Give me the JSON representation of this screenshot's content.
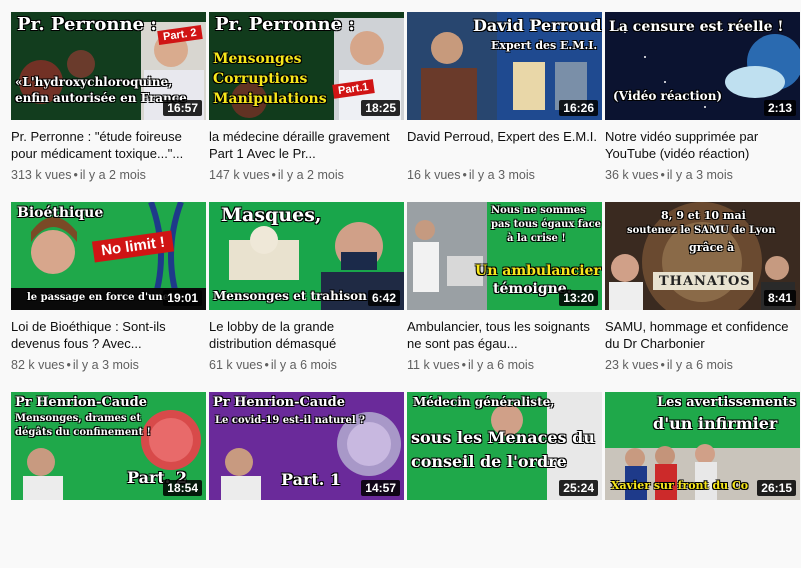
{
  "videos": [
    {
      "thumb_title": "Pr. Perronne :",
      "thumb_text": "«L'hydroxychloroquine,",
      "thumb_text2": "enfin autorisée en France",
      "badge": "Part. 2",
      "duration": "16:57",
      "title": "Pr. Perronne : \"étude foireuse pour médicament toxique...\"...",
      "views": "313 k vues",
      "age": "il y a 2 mois"
    },
    {
      "thumb_title": "Pr. Perronne :",
      "thumb_text": "Mensonges",
      "thumb_text2": "Corruptions",
      "thumb_text3": "Manipulations",
      "badge": "Part.1",
      "duration": "18:25",
      "title": "la médecine déraille gravement Part 1 Avec le Pr...",
      "views": "147 k vues",
      "age": "il y a 2 mois"
    },
    {
      "thumb_title": "David Perroud",
      "thumb_text": "Expert des E.M.I.",
      "duration": "16:26",
      "title": "David Perroud, Expert des E.M.I.",
      "views": "16 k vues",
      "age": "il y a 3 mois"
    },
    {
      "thumb_title": "La censure est réelle !",
      "thumb_text": "(Vidéo réaction)",
      "duration": "2:13",
      "title": "Notre vidéo supprimée par YouTube (vidéo réaction)",
      "views": "36 k vues",
      "age": "il y a 3 mois"
    },
    {
      "thumb_title": "Bioéthique",
      "thumb_text": "No limit !",
      "thumb_text2": "le passage en force d'une",
      "duration": "19:01",
      "title": "Loi de Bioéthique : Sont-ils devenus fous ? Avec...",
      "views": "82 k vues",
      "age": "il y a 3 mois"
    },
    {
      "thumb_title": "Masques,",
      "thumb_text": "Mensonges et trahison",
      "duration": "6:42",
      "title": "Le lobby de la grande distribution démasqué",
      "views": "61 k vues",
      "age": "il y a 6 mois"
    },
    {
      "thumb_title": "Nous ne sommes",
      "thumb_text": "pas tous égaux face",
      "thumb_text2": "à la crise !",
      "thumb_text3": "Un ambulancier",
      "thumb_text4": "témoigne.",
      "duration": "13:20",
      "title": "Ambulancier, tous les soignants ne sont pas égau...",
      "views": "11 k vues",
      "age": "il y a 6 mois"
    },
    {
      "thumb_title": "8, 9 et 10 mai",
      "thumb_text": "soutenez le SAMU de Lyon",
      "thumb_text2": "grâce à",
      "thumb_text3": "THANATOS",
      "duration": "8:41",
      "title": "SAMU, hommage et confidence du Dr Charbonier",
      "views": "23 k vues",
      "age": "il y a 6 mois"
    },
    {
      "thumb_title": "Pr Henrion-Caude",
      "thumb_text": "Mensonges, drames et",
      "thumb_text2": "dégâts du confinement !",
      "thumb_text3": "Part. 2",
      "duration": "18:54",
      "title": "",
      "views": "",
      "age": ""
    },
    {
      "thumb_title": "Pr Henrion-Caude",
      "thumb_text": "Le covid-19 est-il naturel ?",
      "thumb_text2": "Part. 1",
      "duration": "14:57",
      "title": "",
      "views": "",
      "age": ""
    },
    {
      "thumb_title": "Médecin généraliste,",
      "thumb_text": "sous les Menaces du",
      "thumb_text2": "conseil de l'ordre",
      "duration": "25:24",
      "title": "",
      "views": "",
      "age": ""
    },
    {
      "thumb_title": "Les avertissements",
      "thumb_text": "d'un infirmier",
      "thumb_text2": "Xavier sur front du Co",
      "duration": "26:15",
      "title": "",
      "views": "",
      "age": ""
    }
  ],
  "meta_separator": "•",
  "colors": {
    "page_bg": "#f9f9f9",
    "green": "#1fa84a",
    "dark_green": "#134a22",
    "badge_red": "#d01414",
    "highlight_yellow": "#f7e71b",
    "purple": "#6a2a9a",
    "blue_brown": "#1f4a90"
  }
}
